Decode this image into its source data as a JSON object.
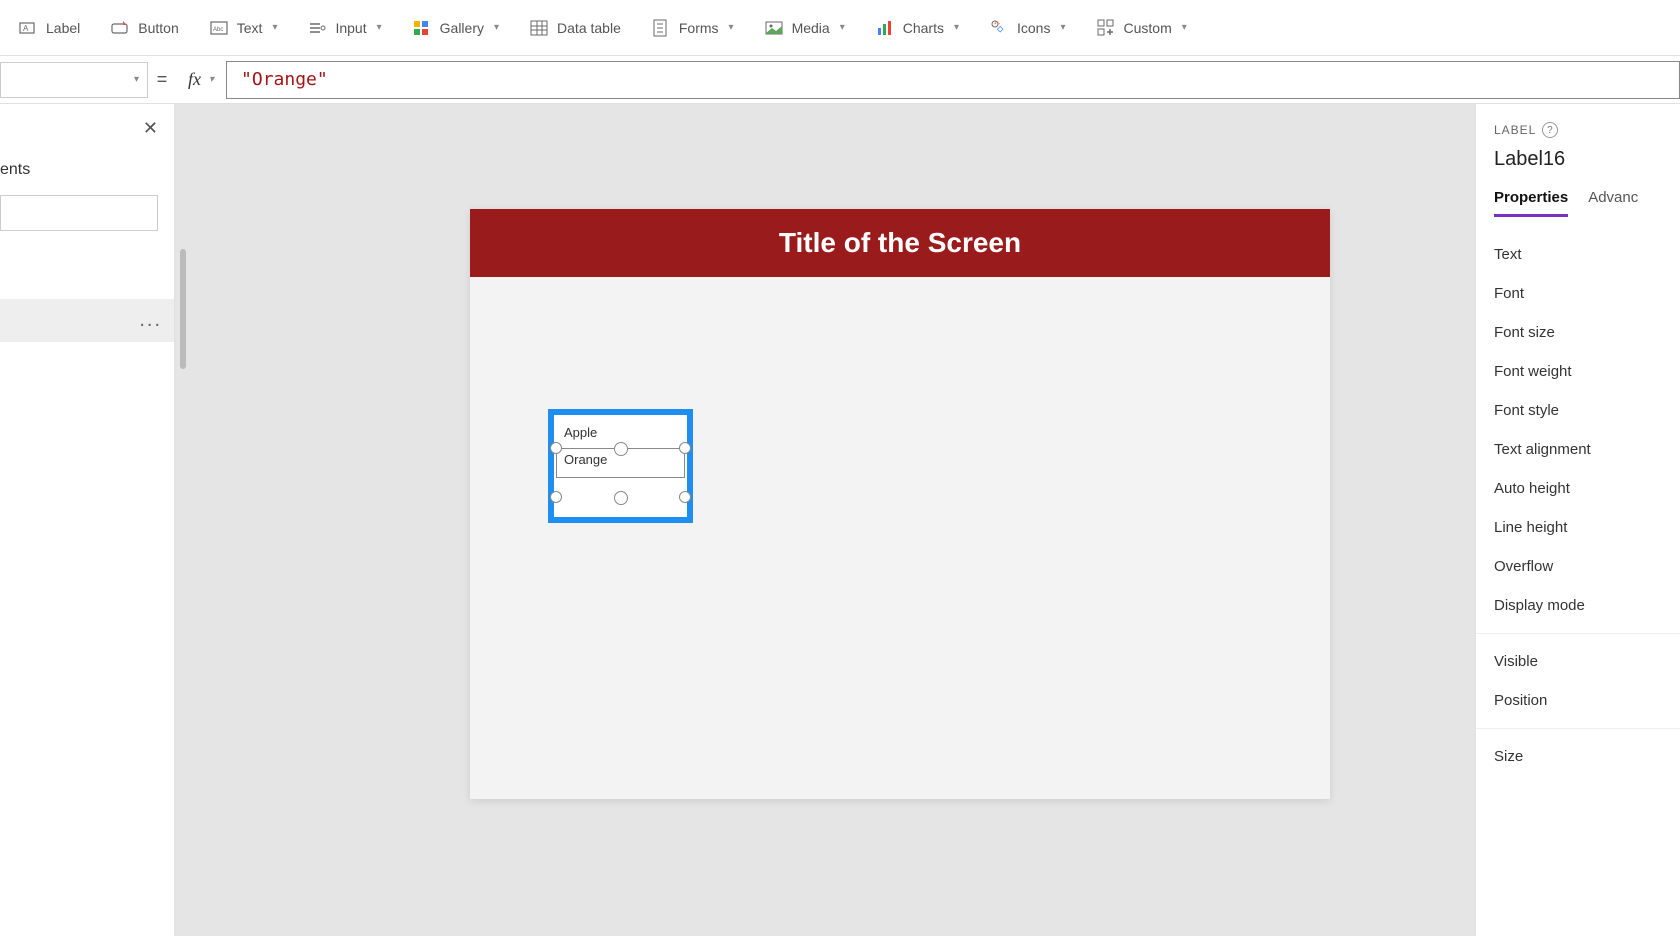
{
  "ribbon": {
    "label": "Label",
    "button": "Button",
    "text": "Text",
    "input": "Input",
    "gallery": "Gallery",
    "data_table": "Data table",
    "forms": "Forms",
    "media": "Media",
    "charts": "Charts",
    "icons": "Icons",
    "custom": "Custom"
  },
  "formula": {
    "equals": "=",
    "fx": "fx",
    "value": "\"Orange\""
  },
  "left_panel": {
    "subtitle_fragment": "ents",
    "more": "..."
  },
  "canvas": {
    "screen_title": "Title of the Screen",
    "listbox": {
      "item1": "Apple",
      "item2": "Orange"
    }
  },
  "right_panel": {
    "type": "LABEL",
    "name": "Label16",
    "tabs": {
      "properties": "Properties",
      "advanced": "Advanc"
    },
    "props": [
      "Text",
      "Font",
      "Font size",
      "Font weight",
      "Font style",
      "Text alignment",
      "Auto height",
      "Line height",
      "Overflow",
      "Display mode"
    ],
    "props2": [
      "Visible",
      "Position"
    ],
    "props3": [
      "Size"
    ]
  }
}
